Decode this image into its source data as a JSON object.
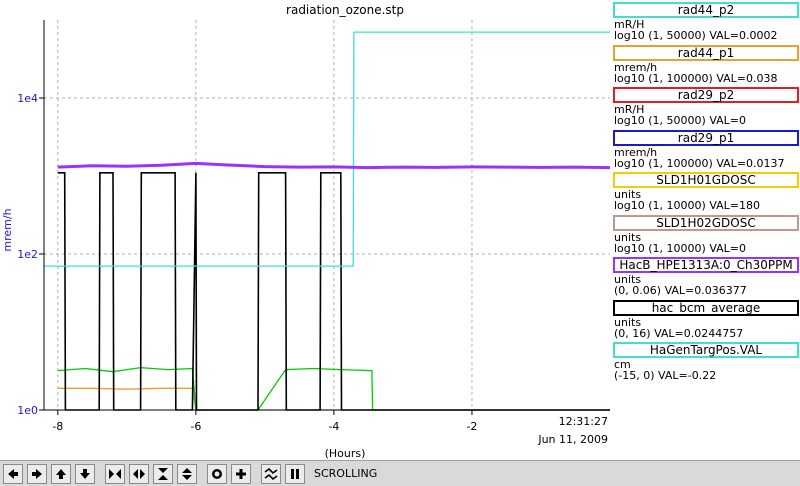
{
  "window": {
    "title": "radiation_ozone.stp"
  },
  "axes": {
    "ylabel": "mrem/h",
    "xlabel": "(Hours)",
    "y_ticks": [
      "1e4",
      "1e2",
      "1e0"
    ],
    "x_ticks": [
      "-8",
      "-6",
      "-4",
      "-2"
    ],
    "timestamp_time": "12:31:27",
    "timestamp_date": "Jun 11, 2009"
  },
  "chart_data": {
    "type": "line",
    "title": "radiation_ozone.stp",
    "xlabel": "(Hours)",
    "ylabel": "mrem/h",
    "xlim": [
      -8.2,
      0.0
    ],
    "y_scale": "log",
    "ylim": [
      1,
      100000
    ],
    "grid": true,
    "legend_placement": "right",
    "series": [
      {
        "name": "HaGenTargPos.VAL",
        "color": "#40e0d0",
        "x": [
          -8.2,
          -3.72,
          -3.71,
          0.0
        ],
        "y": [
          70,
          70,
          70000,
          70000
        ]
      },
      {
        "name": "HacB_HPE1313A:0_Ch30PPM",
        "color": "#9b30ff",
        "x": [
          -8.0,
          -7.5,
          -7.0,
          -6.5,
          -6.0,
          -5.5,
          -5.0,
          -4.5,
          -4.0,
          -3.5,
          -3.0,
          -2.5,
          -2.0,
          -1.5,
          -1.0,
          -0.5,
          0.0
        ],
        "y": [
          1300,
          1350,
          1330,
          1370,
          1450,
          1380,
          1320,
          1300,
          1310,
          1280,
          1300,
          1290,
          1310,
          1300,
          1290,
          1300,
          1280
        ]
      },
      {
        "name": "hac_bcm_average",
        "color": "#000000",
        "x": [
          -8.0,
          -7.9,
          -7.89,
          -7.4,
          -7.39,
          -7.2,
          -7.19,
          -6.8,
          -6.79,
          -6.3,
          -6.29,
          -6.05,
          -6.0,
          -5.99,
          -5.1,
          -5.09,
          -4.7,
          -4.69,
          -4.2,
          -4.19,
          -3.9,
          -3.89,
          -3.45,
          -3.44,
          0.0
        ],
        "y": [
          1100,
          1100,
          1,
          1,
          1100,
          1100,
          1,
          1,
          1100,
          1100,
          1,
          1,
          1100,
          1,
          1,
          1100,
          1100,
          1,
          1,
          1100,
          1100,
          1,
          1,
          1,
          1
        ]
      },
      {
        "name": "SLD1H01GDOSC",
        "color": "#00cc00",
        "x": [
          -8.0,
          -7.6,
          -7.2,
          -6.8,
          -6.4,
          -6.05,
          -6.0,
          -5.1,
          -4.7,
          -4.3,
          -3.9,
          -3.45,
          -3.44,
          0.0
        ],
        "y": [
          3.2,
          3.4,
          3.1,
          3.5,
          3.3,
          3.4,
          1,
          1,
          3.3,
          3.4,
          3.3,
          3.2,
          1,
          1
        ]
      },
      {
        "name": "rad44_p1",
        "color": "#e8a030",
        "x": [
          -8.0,
          -7.5,
          -7.0,
          -6.5,
          -6.05,
          -6.0,
          0.0
        ],
        "y": [
          1.9,
          1.9,
          1.85,
          1.9,
          1.9,
          1,
          1
        ]
      }
    ]
  },
  "legend": [
    {
      "name": "rad44_p2",
      "unit": "mR/H",
      "range": "log10 (1, 50000) VAL=0.0002",
      "color": "#40e0d0"
    },
    {
      "name": "rad44_p1",
      "unit": "mrem/h",
      "range": "log10 (1, 100000) VAL=0.038",
      "color": "#e8a030"
    },
    {
      "name": "rad29_p2",
      "unit": "mR/H",
      "range": "log10 (1, 50000) VAL=0",
      "color": "#e02020"
    },
    {
      "name": "rad29_p1",
      "unit": "mrem/h",
      "range": "log10 (1, 100000) VAL=0.0137",
      "color": "#1a1acc"
    },
    {
      "name": "SLD1H01GDOSC",
      "unit": "units",
      "range": "log10 (1, 10000) VAL=180",
      "color": "#f0d000"
    },
    {
      "name": "SLD1H02GDOSC",
      "unit": "units",
      "range": "log10 (1, 10000) VAL=0",
      "color": "#c09890"
    },
    {
      "name": "HacB_HPE1313A:0_Ch30PPM",
      "unit": "units",
      "range": "(0, 0.06) VAL=0.036377",
      "color": "#9b30ff"
    },
    {
      "name": "hac_bcm_average",
      "unit": "units",
      "range": "(0, 16) VAL=0.0244757",
      "color": "#000000"
    },
    {
      "name": "HaGenTargPos.VAL",
      "unit": "cm",
      "range": "(-15, 0) VAL=-0.22",
      "color": "#40e0d0"
    }
  ],
  "toolbar": {
    "status": "SCROLLING",
    "buttons": [
      "arrow-left-icon",
      "arrow-right-icon",
      "arrow-up-icon",
      "arrow-down-icon",
      "zoom-in-horizontal-icon",
      "zoom-out-horizontal-icon",
      "zoom-in-vertical-icon",
      "zoom-out-vertical-icon",
      "center-icon",
      "crosshair-icon",
      "fit-icon",
      "pause-icon"
    ]
  }
}
